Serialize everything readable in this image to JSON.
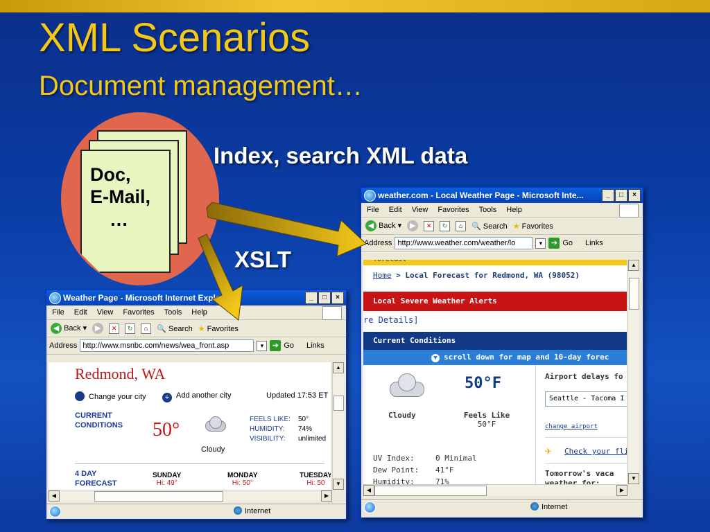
{
  "slide": {
    "title": "XML Scenarios",
    "subtitle": "Document management…",
    "label_index": "Index, search  XML data",
    "label_xslt": "XSLT",
    "doc_lines": [
      "Doc,",
      "E-Mail,",
      "…"
    ]
  },
  "browser_left": {
    "title": "Weather Page - Microsoft Internet Explorer",
    "menu": [
      "File",
      "Edit",
      "View",
      "Favorites",
      "Tools",
      "Help"
    ],
    "toolbar": {
      "back": "Back",
      "search": "Search",
      "favorites": "Favorites"
    },
    "address_label": "Address",
    "address": "http://www.msnbc.com/news/wea_front.asp",
    "go": "Go",
    "links": "Links",
    "status": "Internet",
    "page": {
      "city": "Redmond, WA",
      "change_city": "Change your city",
      "add_city": "Add another city",
      "updated": "Updated 17:53 ET",
      "current_label": "CURRENT\nCONDITIONS",
      "temp": "50°",
      "condition": "Cloudy",
      "feels_label": "FEELS LIKE:",
      "feels_value": "50°",
      "humidity_label": "HUMIDITY:",
      "humidity_value": "74%",
      "visibility_label": "VISIBILITY:",
      "visibility_value": "unlimited",
      "forecast_label": "4 DAY\nFORECAST",
      "days": [
        {
          "name": "SUNDAY",
          "hi": "Hi: 49°"
        },
        {
          "name": "MONDAY",
          "hi": "Hi: 50°"
        },
        {
          "name": "TUESDAY",
          "hi": "Hi: 50"
        }
      ]
    }
  },
  "browser_right": {
    "title": "weather.com - Local Weather Page - Microsoft Inte...",
    "menu": [
      "File",
      "Edit",
      "View",
      "Favorites",
      "Tools",
      "Help"
    ],
    "toolbar": {
      "back": "Back",
      "search": "Search",
      "favorites": "Favorites"
    },
    "address_label": "Address",
    "address": "http://www.weather.com/weather/lo",
    "go": "Go",
    "links": "Links",
    "status": "Internet",
    "page": {
      "forecast_tab": "forecast",
      "breadcrumb_home": "Home",
      "breadcrumb_rest": " > Local Forecast for Redmond, WA (98052)",
      "alerts": "Local Severe Weather Alerts",
      "details": "re Details]",
      "current": "Current Conditions",
      "scroll_note": "scroll down for map and 10-day forec",
      "condition": "Cloudy",
      "temp": "50°F",
      "feels_like_label": "Feels Like",
      "feels_like_value": "50°F",
      "uv_label": "UV Index:",
      "uv_value": "0 Minimal",
      "dew_label": "Dew Point:",
      "dew_value": "41°F",
      "humidity_label": "Humidity:",
      "humidity_value": "71%",
      "airport_heading": "Airport delays fo",
      "airport_select": "Seattle - Tacoma I",
      "change_airport": "change airport",
      "check_flight": "Check your flig",
      "vacation": "Tomorrow's vaca\nweather for:"
    }
  }
}
